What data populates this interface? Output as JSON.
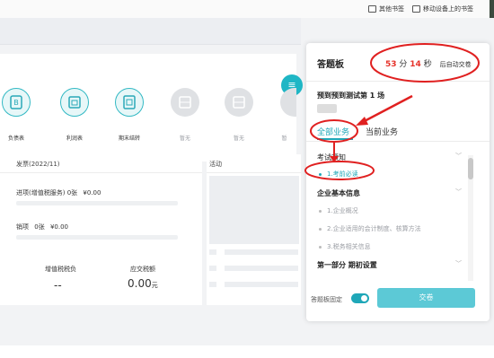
{
  "browser": {
    "bookmarks": [
      {
        "label": "其他书签"
      },
      {
        "label": "移动设备上的书签"
      }
    ]
  },
  "toolbar": {
    "fab_label": "≡"
  },
  "icons": [
    {
      "label": "负债表",
      "icon": "balance-sheet-icon",
      "state": "active"
    },
    {
      "label": "利润表",
      "icon": "income-statement-icon",
      "state": "active"
    },
    {
      "label": "期末结转",
      "icon": "period-end-transfer-icon",
      "state": "active"
    },
    {
      "label": "暂无",
      "icon": "empty-slot-icon",
      "state": "muted"
    },
    {
      "label": "暂无",
      "icon": "empty-slot-icon",
      "state": "muted"
    },
    {
      "label": "暂",
      "icon": "empty-slot-icon",
      "state": "muted"
    }
  ],
  "invoice_card": {
    "title": "发票(2022/11)",
    "row1_label": "进项(增值税服务)",
    "row1_count": "0张",
    "row1_amount": "¥0.00",
    "row2_label": "销项",
    "row2_count": "0张",
    "row2_amount": "¥0.00",
    "tax_label": "增值税税负",
    "tax_value": "--",
    "due_label": "应交税额",
    "due_value": "0.00",
    "due_unit": "元"
  },
  "activity_card": {
    "title": "活动"
  },
  "panel": {
    "title": "答题板",
    "timer": {
      "minutes": "53",
      "min_unit": "分",
      "seconds": "14",
      "sec_unit": "秒",
      "tail": "后自动交卷"
    },
    "exam_title": "预到预到测试第 1 场",
    "tabs": [
      {
        "label": "全部业务",
        "active": true
      },
      {
        "label": "当前业务",
        "active": false
      }
    ],
    "sections": [
      {
        "label": "考试须知",
        "items": [
          {
            "label": "1.考前必读",
            "current": true
          }
        ]
      },
      {
        "label": "企业基本信息",
        "items": [
          {
            "label": "1.企业概况",
            "current": false
          },
          {
            "label": "2.企业适用的会计制度、核算方法",
            "current": false
          },
          {
            "label": "3.税务相关信息",
            "current": false
          }
        ]
      },
      {
        "label": "第一部分 期初设置",
        "items": []
      }
    ],
    "pin_label": "答题板固定",
    "pin_on": true,
    "submit_label": "交卷"
  },
  "colors": {
    "accent": "#1fa7b8",
    "timer_red": "#e6332a",
    "annotation_red": "#e02020"
  }
}
